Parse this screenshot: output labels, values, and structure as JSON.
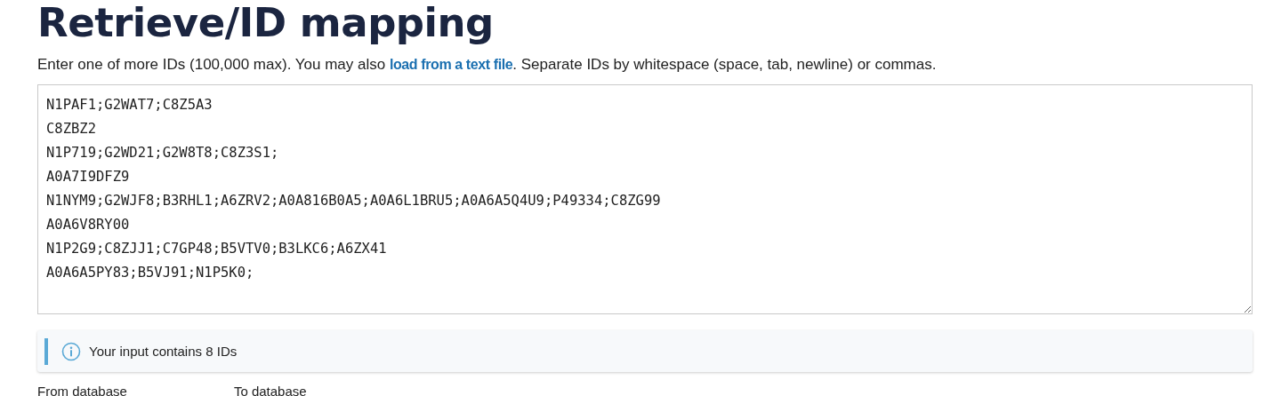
{
  "title": "Retrieve/ID mapping",
  "intro": {
    "before": "Enter one of more IDs (100,000 max). You may also ",
    "link": "load from a text file",
    "after": ". Separate IDs by whitespace (space, tab, newline) or commas."
  },
  "ids_input": {
    "value": "N1PAF1;G2WAT7;C8Z5A3\nC8ZBZ2\nN1P719;G2WD21;G2W8T8;C8Z3S1;\nA0A7I9DFZ9\nN1NYM9;G2WJF8;B3RHL1;A6ZRV2;A0A816B0A5;A0A6L1BRU5;A0A6A5Q4U9;P49334;C8ZG99\nA0A6V8RY00\nN1P2G9;C8ZJJ1;C7GP48;B5VTV0;B3LKC6;A6ZX41\nA0A6A5PY83;B5VJ91;N1P5K0;"
  },
  "message": {
    "kind": "info",
    "text": "Your input contains 8 IDs"
  },
  "fields": [
    {
      "label": "From database"
    },
    {
      "label": "To database"
    }
  ]
}
